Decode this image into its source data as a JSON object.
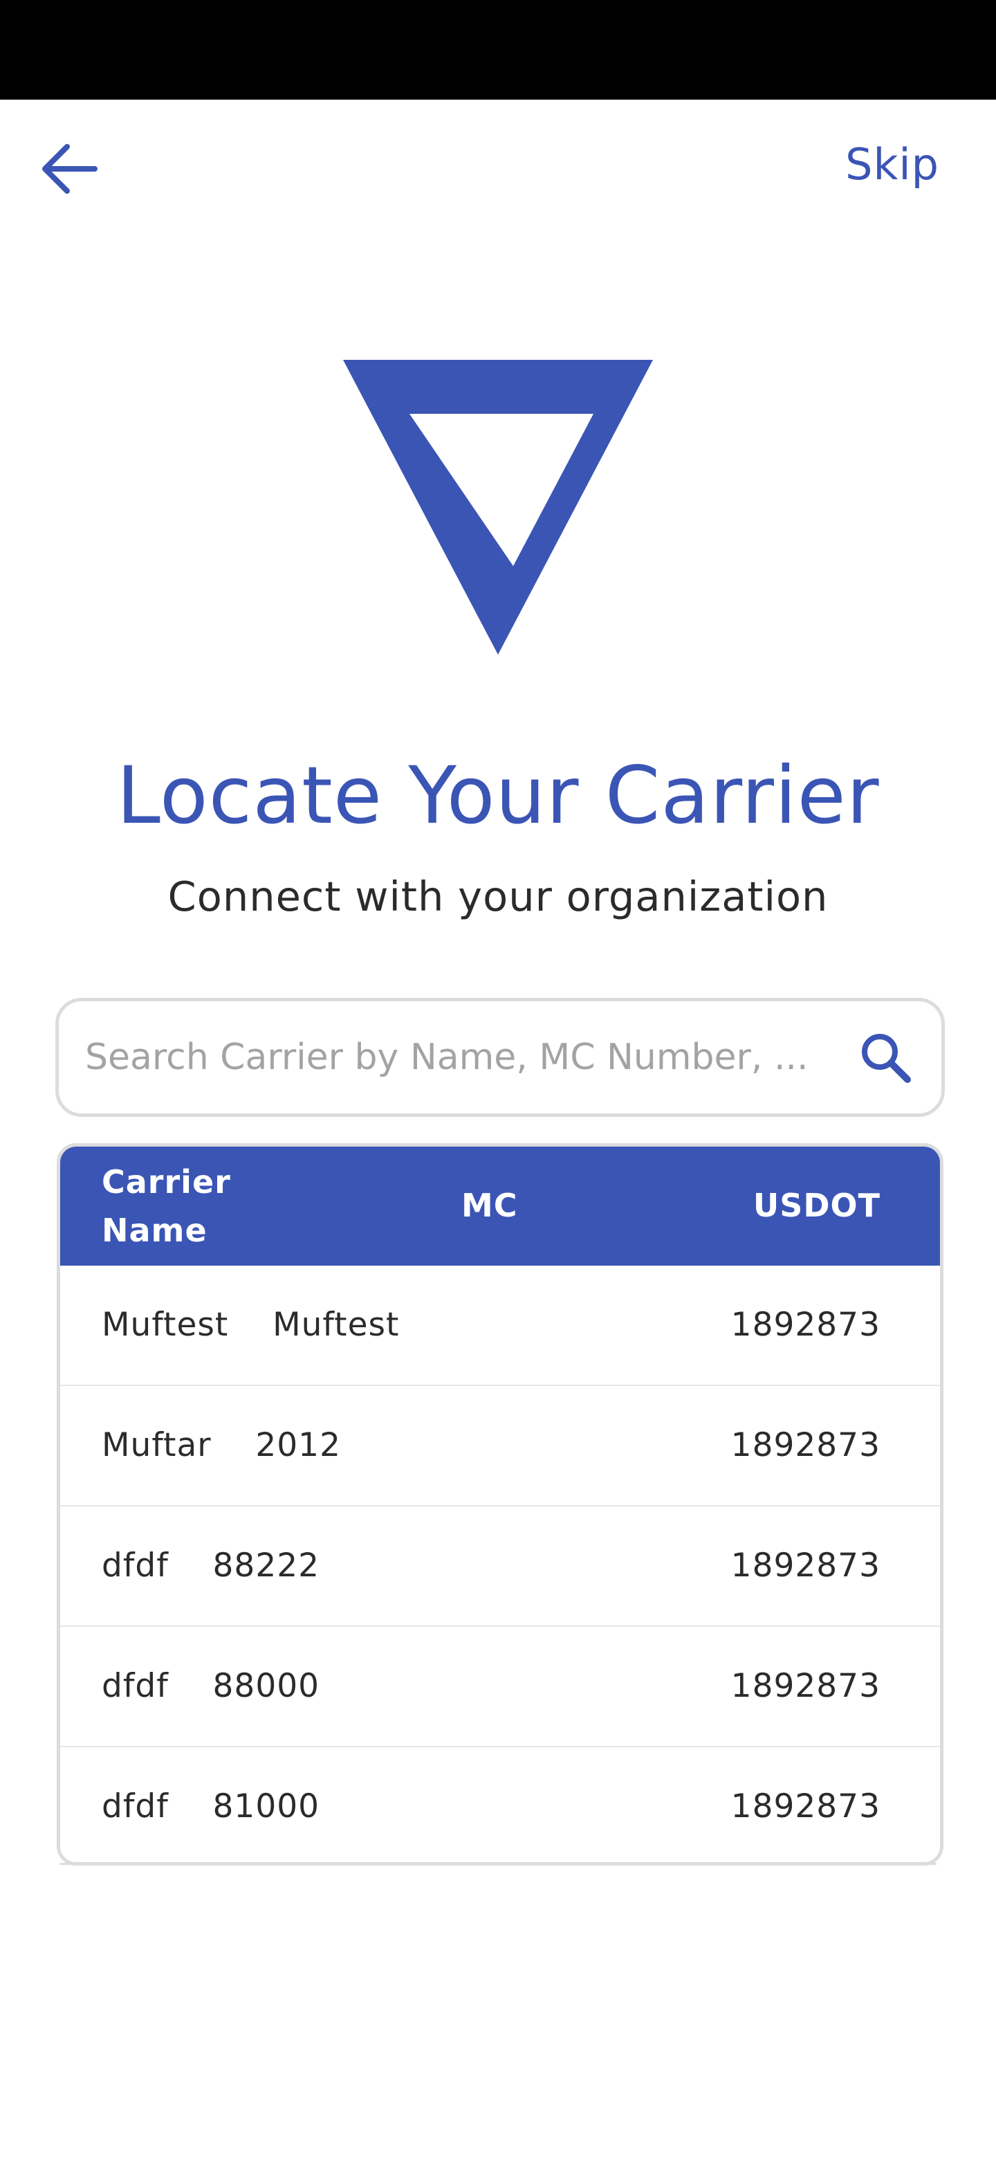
{
  "colors": {
    "brand": "#3b55b5",
    "text": "#2b2b2b",
    "placeholder": "#a3a3a3",
    "border": "#dcdcdc"
  },
  "header": {
    "back_icon": "arrow-left-icon",
    "skip_label": "Skip"
  },
  "logo": {
    "icon": "triangle-logo-icon"
  },
  "title": "Locate Your Carrier",
  "subtitle": "Connect with your organization",
  "search": {
    "placeholder": "Search Carrier by Name, MC Number, ...",
    "value": "",
    "icon": "search-icon"
  },
  "table": {
    "headers": {
      "name": "Carrier Name",
      "mc": "MC",
      "usdot": "USDOT"
    },
    "rows": [
      {
        "name": "Muftest    Muftest",
        "mc": "",
        "usdot": "1892873"
      },
      {
        "name": "Muftar    2012",
        "mc": "",
        "usdot": "1892873"
      },
      {
        "name": "dfdf    88222",
        "mc": "",
        "usdot": "1892873"
      },
      {
        "name": "dfdf    88000",
        "mc": "",
        "usdot": "1892873"
      },
      {
        "name": "dfdf    81000",
        "mc": "",
        "usdot": "1892873"
      }
    ]
  }
}
